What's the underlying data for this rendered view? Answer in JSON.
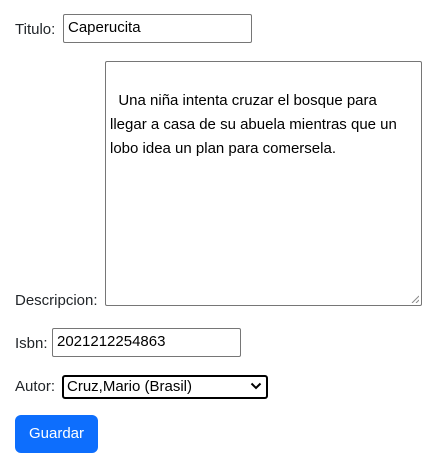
{
  "form": {
    "titulo": {
      "label": "Titulo:",
      "value": "Caperucita"
    },
    "descripcion": {
      "label": "Descripcion:",
      "value": "Una niña intenta cruzar el bosque para llegar a casa de su abuela mientras que un lobo idea un plan para comersela."
    },
    "isbn": {
      "label": "Isbn:",
      "value": "2021212254863"
    },
    "autor": {
      "label": "Autor:",
      "selected": "Cruz,Mario (Brasil)"
    },
    "submit_label": "Guardar"
  },
  "colors": {
    "button_bg": "#0d6efd",
    "button_text": "#ffffff",
    "text": "#212529"
  },
  "icons": {
    "select_arrow": "chevron-down-icon",
    "textarea_grip": "resize-grip-icon"
  }
}
